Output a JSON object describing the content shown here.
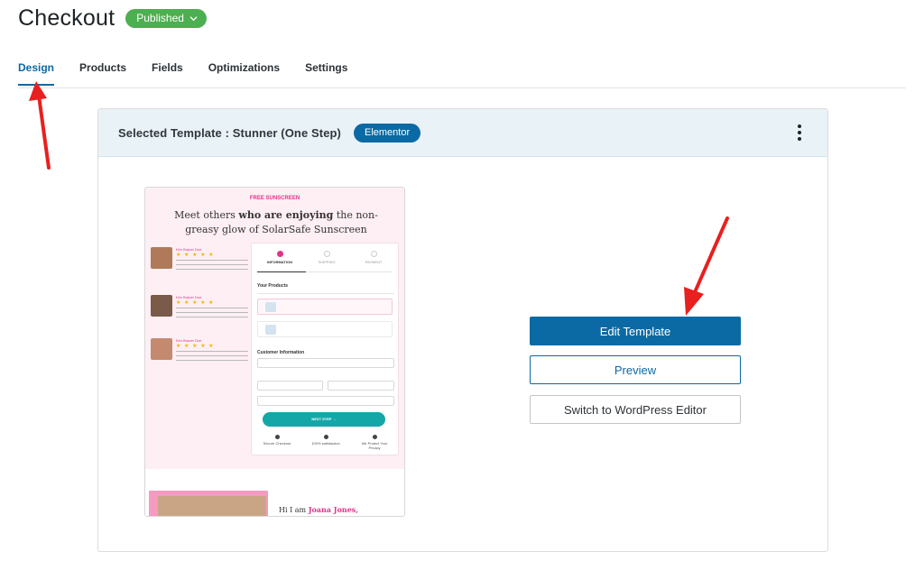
{
  "header": {
    "title": "Checkout",
    "status": "Published"
  },
  "tabs": [
    {
      "label": "Design",
      "active": true
    },
    {
      "label": "Products"
    },
    {
      "label": "Fields"
    },
    {
      "label": "Optimizations"
    },
    {
      "label": "Settings"
    }
  ],
  "template_card": {
    "selected_label": "Selected Template :  Stunner  (One Step)",
    "builder_badge": "Elementor",
    "actions": {
      "edit": "Edit Template",
      "preview": "Preview",
      "switch": "Switch to WordPress Editor"
    }
  },
  "preview": {
    "kicker": "FREE SUNSCREEN",
    "headline_pre": "Meet others ",
    "headline_bold": "who are enjoying",
    "headline_post": " the non-greasy glow of SolarSafe Sunscreen",
    "review_name": "Kim Brauer Doe",
    "stars": "★ ★ ★ ★ ★",
    "steps": [
      "INFORMATION",
      "SHIPPING",
      "PAYMENT"
    ],
    "your_products": "Your Products",
    "customer_information": "Customer Information",
    "next_step": "NEXT STEP →",
    "trust": [
      "Secure Checkout",
      "100% satisfaction",
      "We Protect Your Privacy"
    ],
    "hi_pre": "Hi I am ",
    "hi_name": "Joana Jones,"
  },
  "colors": {
    "accent": "#0b6aa3",
    "status_green": "#4caf50",
    "arrow_red": "#e8201f",
    "pink": "#e4328a",
    "teal": "#14a7a7"
  }
}
